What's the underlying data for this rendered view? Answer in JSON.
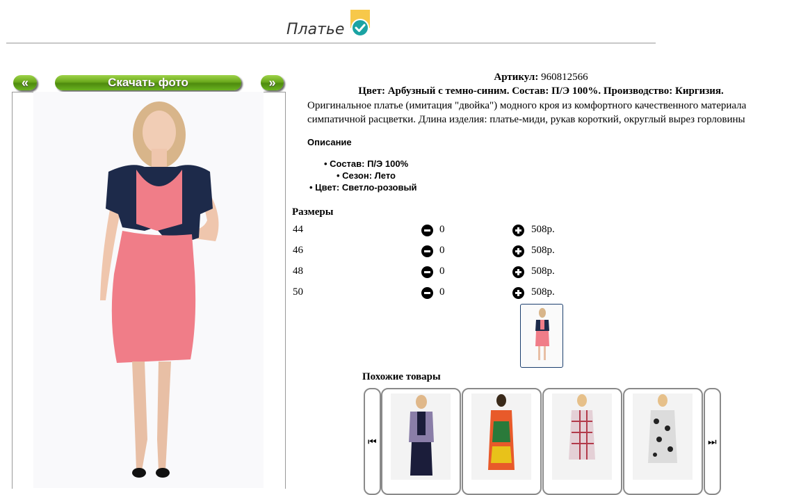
{
  "page": {
    "title": "Платье"
  },
  "gallery": {
    "prev_label": "«",
    "download_label": "Скачать фото",
    "next_label": "»"
  },
  "product": {
    "article_label": "Артикул:",
    "article_value": "960812566",
    "composition_line": "Цвет: Арбузный с темно-синим. Состав: П/Э 100%. Производство: Киргизия.",
    "description_line1": "Оригинальное платье (имитация \"двойка\") модного кроя из комфортного качественного материала",
    "description_line2": "симпатичной расцветки. Длина изделия: платье-миди, рукав короткий, округлый вырез горловины",
    "description_heading": "Описание",
    "bullets": [
      "Состав: П/Э 100%",
      "Сезон: Лето",
      "Цвет: Светло-розовый"
    ]
  },
  "sizes": {
    "heading": "Размеры",
    "rows": [
      {
        "size": "44",
        "qty": "0",
        "price": "508р."
      },
      {
        "size": "46",
        "qty": "0",
        "price": "508р."
      },
      {
        "size": "48",
        "qty": "0",
        "price": "508р."
      },
      {
        "size": "50",
        "qty": "0",
        "price": "508р."
      }
    ]
  },
  "similar": {
    "heading": "Похожие товары",
    "count": 4
  },
  "colors": {
    "green_button": "#6aa91c",
    "dress_pink": "#f07d88",
    "jacket_navy": "#1d2a4a",
    "badge_yellow": "#f7c84a",
    "badge_teal": "#1aa3a3"
  },
  "icons": {
    "badge": "check-badge-icon",
    "minus": "minus-circle-icon",
    "plus": "plus-circle-icon",
    "carousel_prev": "skip-previous-icon",
    "carousel_next": "skip-next-icon"
  }
}
